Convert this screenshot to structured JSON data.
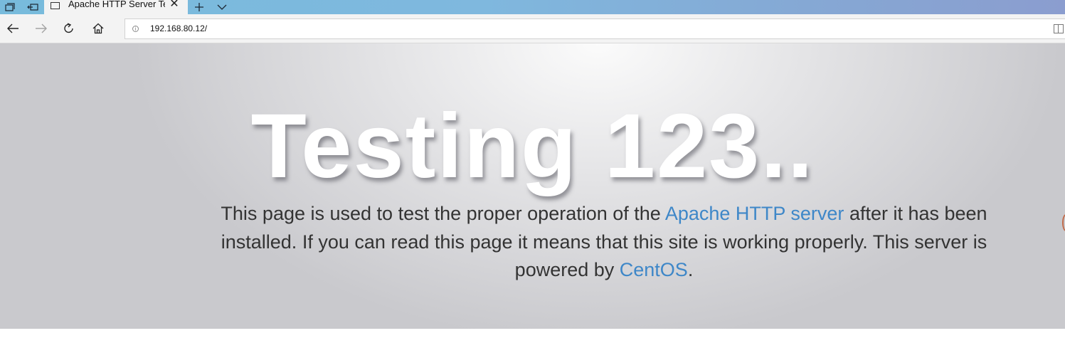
{
  "browser": {
    "tab": {
      "title": "Apache HTTP Server Tes"
    },
    "address_bar": {
      "url": "192.168.80.12/"
    },
    "icons": {
      "set_aside": "tabs-aside-icon",
      "show_aside": "show-tabs-aside-icon",
      "tab_favicon": "page-icon",
      "close": "close-icon",
      "new_tab": "plus-icon",
      "tab_list": "chevron-down-icon",
      "back": "back-arrow-icon",
      "forward": "forward-arrow-icon",
      "refresh": "refresh-icon",
      "home": "home-icon",
      "info": "info-icon",
      "reading_view": "reading-view-icon"
    }
  },
  "page": {
    "headline": "Testing 123..",
    "lead": {
      "text1": "This page is used to test the proper operation of the ",
      "link1": "Apache HTTP server",
      "text2": " after it has been installed. If you can read this page it means that this site is working properly. This server is powered by ",
      "link2": "CentOS",
      "text3": "."
    },
    "colors": {
      "link": "#3e87c8",
      "body_text": "#333333",
      "headline": "#ffffff"
    }
  }
}
